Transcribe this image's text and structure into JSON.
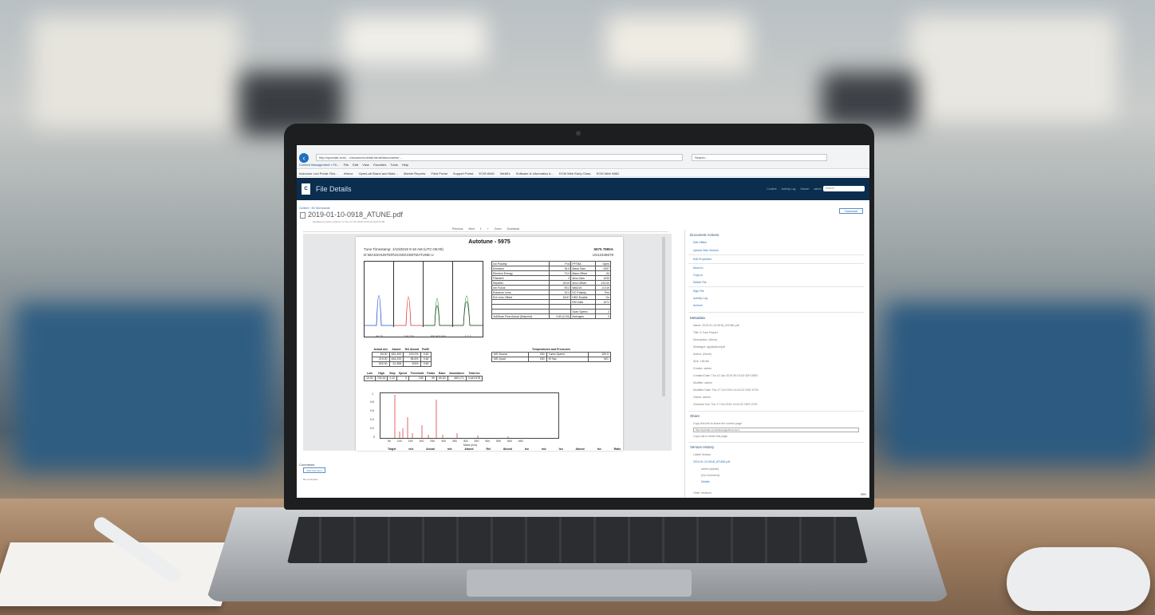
{
  "browser": {
    "url": "http://openlab-ecm/…/document-detail.html#/documents/…",
    "search_placeholder": "Search...",
    "tab_title": "Content Management » Fil...",
    "menu": [
      "File",
      "Edit",
      "View",
      "Favorites",
      "Tools",
      "Help"
    ],
    "favorites": [
      "Instructor Led Portal: Res...",
      "eNova",
      "OpenLab Brand and Mark...",
      "Market Reports",
      "Field Portal",
      "Support Portal",
      "ECM WAD",
      "WebEx",
      "Software & Informatics A...",
      "ECM Web Early Class",
      "ECM Web WAD"
    ],
    "zoom": "95%"
  },
  "app": {
    "title": "File Details",
    "nav": [
      "Content",
      "Activity Log",
      "Search",
      "admin"
    ],
    "search_placeholder": "Search"
  },
  "file": {
    "breadcrumb": "Content › 3D Mol Islands",
    "name": "2019-01-10-0918_ATUNE.pdf",
    "modified": "Modified by admin (admin) on Thu 17 Oct 2019 14:04:22 GMT-0700",
    "download_label": "Download",
    "toolbar": [
      "Previous",
      "Next",
      "1",
      "+",
      "Zoom",
      "Download"
    ]
  },
  "document": {
    "title": "Autotune - 5975",
    "timestamp": "Tune Timestamp: 1/10/2019 9:18 AM (UTC-05:00)",
    "path": "D:\\MASSHUNTER\\GCMS\\1\\5975\\ATUNE.U",
    "instrument": "5975 7890A",
    "serial": "US12345678",
    "peak_axes": [
      "69   70",
      "218   220",
      "500 502 504",
      "1  2  3"
    ],
    "peak_xlabels": [
      "Mass (m/z)",
      "Mass (m/z)",
      "Mass (m/z)",
      "Mass (m/z)"
    ],
    "params": [
      [
        "Ion Polarity",
        "Pos",
        "PFTBA",
        "Open"
      ],
      [
        "Emission",
        "34.6",
        "Mass Gain",
        "-1097"
      ],
      [
        "Electron Energy",
        "70.0",
        "Mass Offset",
        "-34"
      ],
      [
        "Filament",
        "2",
        "Amu Gain",
        "1033"
      ],
      [
        "Repeller",
        "25.00",
        "Amu Offset",
        "123.00"
      ],
      [
        "Ion Focus",
        "90.2",
        "Wid219",
        "-0.019"
      ],
      [
        "Entrance Lens",
        "32.0",
        "DC Polarity",
        "Pos"
      ],
      [
        "Ent Lens Offset",
        "18.57",
        "HED Enable",
        "On"
      ],
      [
        "",
        "",
        "EM Volts",
        "1071"
      ],
      [
        "",
        "",
        "",
        ""
      ],
      [
        "",
        "",
        "Scan Speed",
        "2"
      ],
      [
        "Jet/Dean Flow Actual (Setpoint)",
        "0.60 (0.00)",
        "Averages",
        "3"
      ]
    ],
    "abund_headers": [
      "Actual m/z",
      "Abund",
      "Rel Abund",
      "Pw50"
    ],
    "abund_rows": [
      [
        "69.00",
        "481,493",
        "100.0%",
        "0.60"
      ],
      [
        "219.00",
        "464,233",
        "96.6%",
        "0.60"
      ],
      [
        "502.00",
        "41,308",
        "8.6%",
        "0.60"
      ]
    ],
    "temp_title": "Temperatures and Pressures",
    "temp_rows": [
      [
        "MS Source",
        "230",
        "Turbo Speed",
        "100.0"
      ],
      [
        "MS Quad",
        "150",
        "Hi Vac",
        "N/C"
      ]
    ],
    "scan_headers": [
      "Low",
      "High",
      "Step",
      "Speed",
      "Threshold",
      "Peaks",
      "Base",
      "Abundance",
      "Total Ion"
    ],
    "scan_row": [
      "10.00",
      "700.00",
      "0.10",
      "3",
      "150",
      "99",
      "69.00",
      "469,171",
      "3,443,578"
    ],
    "spectrum_y": [
      "1",
      "0.8",
      "0.6",
      "0.4",
      "0.2",
      "0"
    ],
    "spectrum_x": "50 100 150 200 250 300 350 400 450 500 550 600 650",
    "spectrum_xlabel": "Mass (m/z)",
    "target_headers": "Target m/z   Actual m/z   Abund   Rel Abund   Iso m/z   Iso Abund   Iso Ratio"
  },
  "comments": {
    "title": "Comments",
    "add_label": "Add Comment",
    "empty": "No comments"
  },
  "panel": {
    "actions_title": "Document Actions",
    "actions": [
      "Edit Offline",
      "Upload New Version",
      "Edit Properties",
      "Move to",
      "Copy to",
      "Delete File",
      "Sign File",
      "Activity Log",
      "Archive"
    ],
    "metadata_title": "Metadata",
    "metadata": [
      "Name: 2019-01-10-0918_ATUNE.pdf",
      "Title: 5.Tune Report",
      "Description: (None)",
      "Mimetype: application/pdf",
      "Author: (None)",
      "Size: 155 kB",
      "Creator: admin",
      "Created Date: Thu 10 Jan 2019 09:19:28 GMT-0800",
      "Modifier: admin",
      "Modified Date: Thu 17 Oct 2019 14:04:22 GMT-0700",
      "Owner: admin",
      "Checked Out: Thu 17 Oct 2019 14:04:22 GMT-0700"
    ],
    "share_title": "Share",
    "share_hint": "Copy this link to share the current page",
    "share_url": "http://openlab-ecm/share/page/document...",
    "share_hint2": "Copy link to share this page",
    "history_title": "Version History",
    "latest_label": "Latest Version",
    "latest_file": "2019-01-10-0918_ATUNE.pdf",
    "latest_user": "admin (admin)",
    "latest_comment": "(No Comment)",
    "details_label": "Details",
    "older_label": "Older Versions"
  }
}
